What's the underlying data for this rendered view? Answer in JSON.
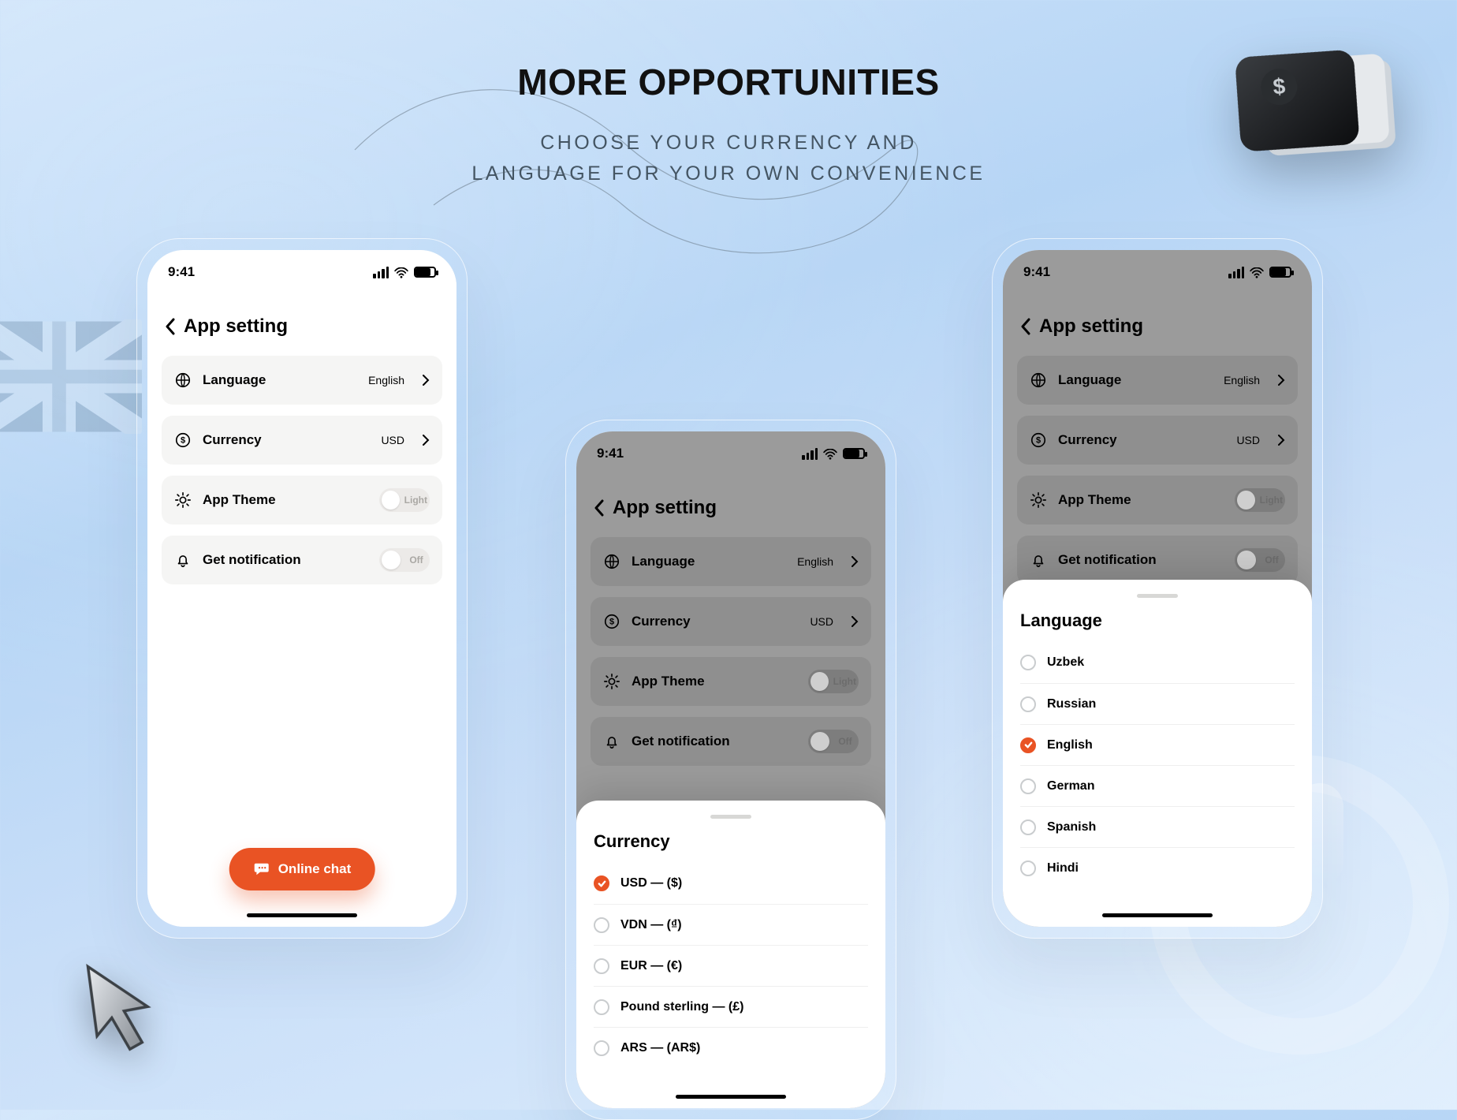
{
  "hero": {
    "title": "MORE OPPORTUNITIES",
    "sub1": "CHOOSE YOUR CURRENCY AND",
    "sub2": "LANGUAGE FOR YOUR OWN CONVENIENCE"
  },
  "status": {
    "time": "9:41"
  },
  "header": {
    "title": "App setting"
  },
  "rows": {
    "language": {
      "label": "Language",
      "value": "English"
    },
    "currency": {
      "label": "Currency",
      "value": "USD"
    },
    "theme": {
      "label": "App Theme",
      "value": "Light"
    },
    "notify": {
      "label": "Get notification",
      "value": "Off"
    }
  },
  "chat": {
    "label": "Online chat"
  },
  "currencySheet": {
    "title": "Currency",
    "options": [
      "USD — ($)",
      "VDN — (₫)",
      "EUR — (€)",
      "Pound sterling — (£)",
      "ARS — (AR$)"
    ],
    "selected": 0
  },
  "languageSheet": {
    "title": "Language",
    "options": [
      "Uzbek",
      "Russian",
      "English",
      "German",
      "Spanish",
      "Hindi"
    ],
    "selected": 2
  }
}
